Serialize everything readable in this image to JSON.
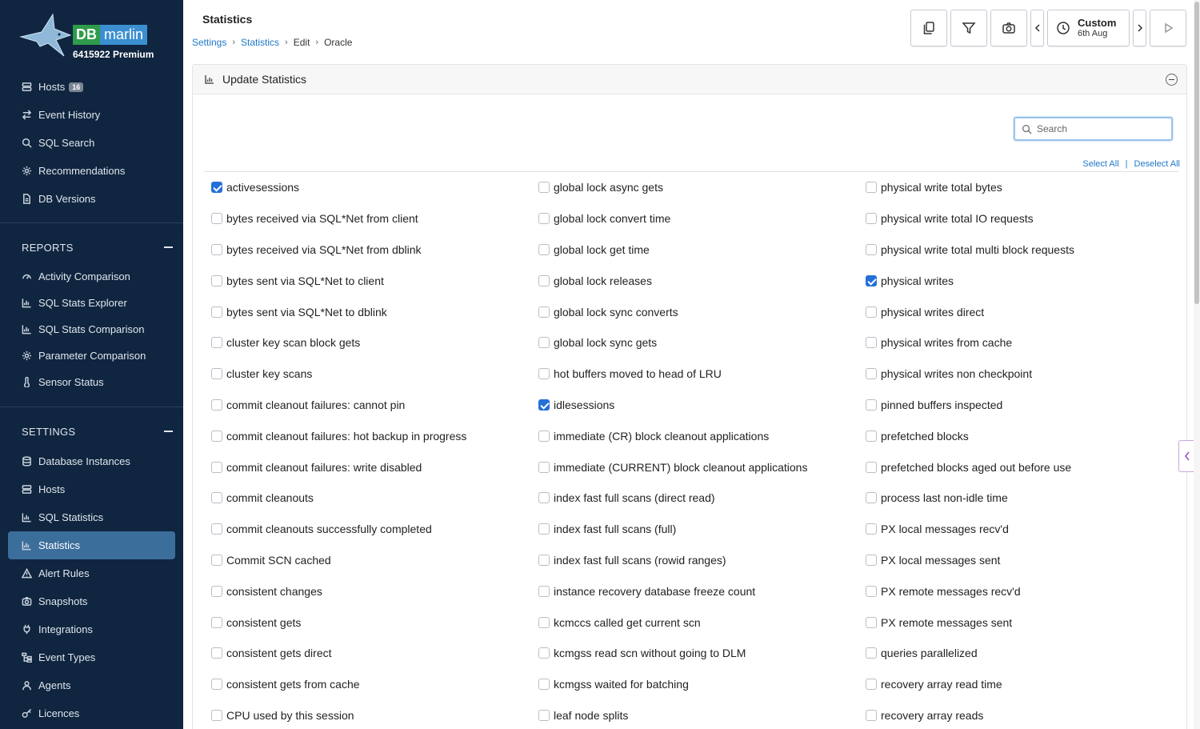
{
  "brand": {
    "db": "DB",
    "marlin": "marlin",
    "plan": "6415922 Premium"
  },
  "nav_top": [
    {
      "label": "Hosts",
      "icon": "server-icon",
      "badge": "16"
    },
    {
      "label": "Event History",
      "icon": "arrows-icon"
    },
    {
      "label": "SQL Search",
      "icon": "search-icon"
    },
    {
      "label": "Recommendations",
      "icon": "gear-icon"
    },
    {
      "label": "DB Versions",
      "icon": "document-icon"
    }
  ],
  "reports": {
    "title": "REPORTS",
    "items": [
      {
        "label": "Activity Comparison",
        "icon": "gauge-icon"
      },
      {
        "label": "SQL Stats Explorer",
        "icon": "chart-icon"
      },
      {
        "label": "SQL Stats Comparison",
        "icon": "chart-icon"
      },
      {
        "label": "Parameter Comparison",
        "icon": "gear-icon"
      },
      {
        "label": "Sensor Status",
        "icon": "thermometer-icon"
      }
    ]
  },
  "settings": {
    "title": "SETTINGS",
    "items": [
      {
        "label": "Database Instances",
        "icon": "database-icon"
      },
      {
        "label": "Hosts",
        "icon": "server-icon"
      },
      {
        "label": "SQL Statistics",
        "icon": "chart-icon"
      },
      {
        "label": "Statistics",
        "icon": "chart-icon",
        "active": true
      },
      {
        "label": "Alert Rules",
        "icon": "warning-icon"
      },
      {
        "label": "Snapshots",
        "icon": "camera-icon"
      },
      {
        "label": "Integrations",
        "icon": "plug-icon"
      },
      {
        "label": "Event Types",
        "icon": "hierarchy-icon"
      },
      {
        "label": "Agents",
        "icon": "agent-icon"
      },
      {
        "label": "Licences",
        "icon": "key-icon"
      }
    ]
  },
  "header": {
    "title": "Statistics",
    "breadcrumb": [
      "Settings",
      "Statistics",
      "Edit",
      "Oracle"
    ],
    "time": {
      "label": "Custom",
      "date": "6th Aug"
    }
  },
  "panel": {
    "title": "Update Statistics",
    "search_placeholder": "Search",
    "select_all": "Select All",
    "separator": "|",
    "deselect_all": "Deselect All"
  },
  "stats_columns": [
    [
      {
        "label": "activesessions",
        "checked": true
      },
      {
        "label": "bytes received via SQL*Net from client",
        "checked": false
      },
      {
        "label": "bytes received via SQL*Net from dblink",
        "checked": false
      },
      {
        "label": "bytes sent via SQL*Net to client",
        "checked": false
      },
      {
        "label": "bytes sent via SQL*Net to dblink",
        "checked": false
      },
      {
        "label": "cluster key scan block gets",
        "checked": false
      },
      {
        "label": "cluster key scans",
        "checked": false
      },
      {
        "label": "commit cleanout failures: cannot pin",
        "checked": false
      },
      {
        "label": "commit cleanout failures: hot backup in progress",
        "checked": false
      },
      {
        "label": "commit cleanout failures: write disabled",
        "checked": false
      },
      {
        "label": "commit cleanouts",
        "checked": false
      },
      {
        "label": "commit cleanouts successfully completed",
        "checked": false
      },
      {
        "label": "Commit SCN cached",
        "checked": false
      },
      {
        "label": "consistent changes",
        "checked": false
      },
      {
        "label": "consistent gets",
        "checked": false
      },
      {
        "label": "consistent gets direct",
        "checked": false
      },
      {
        "label": "consistent gets from cache",
        "checked": false
      },
      {
        "label": "CPU used by this session",
        "checked": false
      }
    ],
    [
      {
        "label": "global lock async gets",
        "checked": false
      },
      {
        "label": "global lock convert time",
        "checked": false
      },
      {
        "label": "global lock get time",
        "checked": false
      },
      {
        "label": "global lock releases",
        "checked": false
      },
      {
        "label": "global lock sync converts",
        "checked": false
      },
      {
        "label": "global lock sync gets",
        "checked": false
      },
      {
        "label": "hot buffers moved to head of LRU",
        "checked": false
      },
      {
        "label": "idlesessions",
        "checked": true
      },
      {
        "label": "immediate (CR) block cleanout applications",
        "checked": false
      },
      {
        "label": "immediate (CURRENT) block cleanout applications",
        "checked": false
      },
      {
        "label": "index fast full scans (direct read)",
        "checked": false
      },
      {
        "label": "index fast full scans (full)",
        "checked": false
      },
      {
        "label": "index fast full scans (rowid ranges)",
        "checked": false
      },
      {
        "label": "instance recovery database freeze count",
        "checked": false
      },
      {
        "label": "kcmccs called get current scn",
        "checked": false
      },
      {
        "label": "kcmgss read scn without going to DLM",
        "checked": false
      },
      {
        "label": "kcmgss waited for batching",
        "checked": false
      },
      {
        "label": "leaf node splits",
        "checked": false
      }
    ],
    [
      {
        "label": "physical write total bytes",
        "checked": false
      },
      {
        "label": "physical write total IO requests",
        "checked": false
      },
      {
        "label": "physical write total multi block requests",
        "checked": false
      },
      {
        "label": "physical writes",
        "checked": true
      },
      {
        "label": "physical writes direct",
        "checked": false
      },
      {
        "label": "physical writes from cache",
        "checked": false
      },
      {
        "label": "physical writes non checkpoint",
        "checked": false
      },
      {
        "label": "pinned buffers inspected",
        "checked": false
      },
      {
        "label": "prefetched blocks",
        "checked": false
      },
      {
        "label": "prefetched blocks aged out before use",
        "checked": false
      },
      {
        "label": "process last non-idle time",
        "checked": false
      },
      {
        "label": "PX local messages recv'd",
        "checked": false
      },
      {
        "label": "PX local messages sent",
        "checked": false
      },
      {
        "label": "PX remote messages recv'd",
        "checked": false
      },
      {
        "label": "PX remote messages sent",
        "checked": false
      },
      {
        "label": "queries parallelized",
        "checked": false
      },
      {
        "label": "recovery array read time",
        "checked": false
      },
      {
        "label": "recovery array reads",
        "checked": false
      }
    ]
  ],
  "colors": {
    "sidebar_bg": "#10253f",
    "active_bg": "#3c6e9c",
    "link": "#1f78c8",
    "checkbox_checked": "#2470d8"
  }
}
